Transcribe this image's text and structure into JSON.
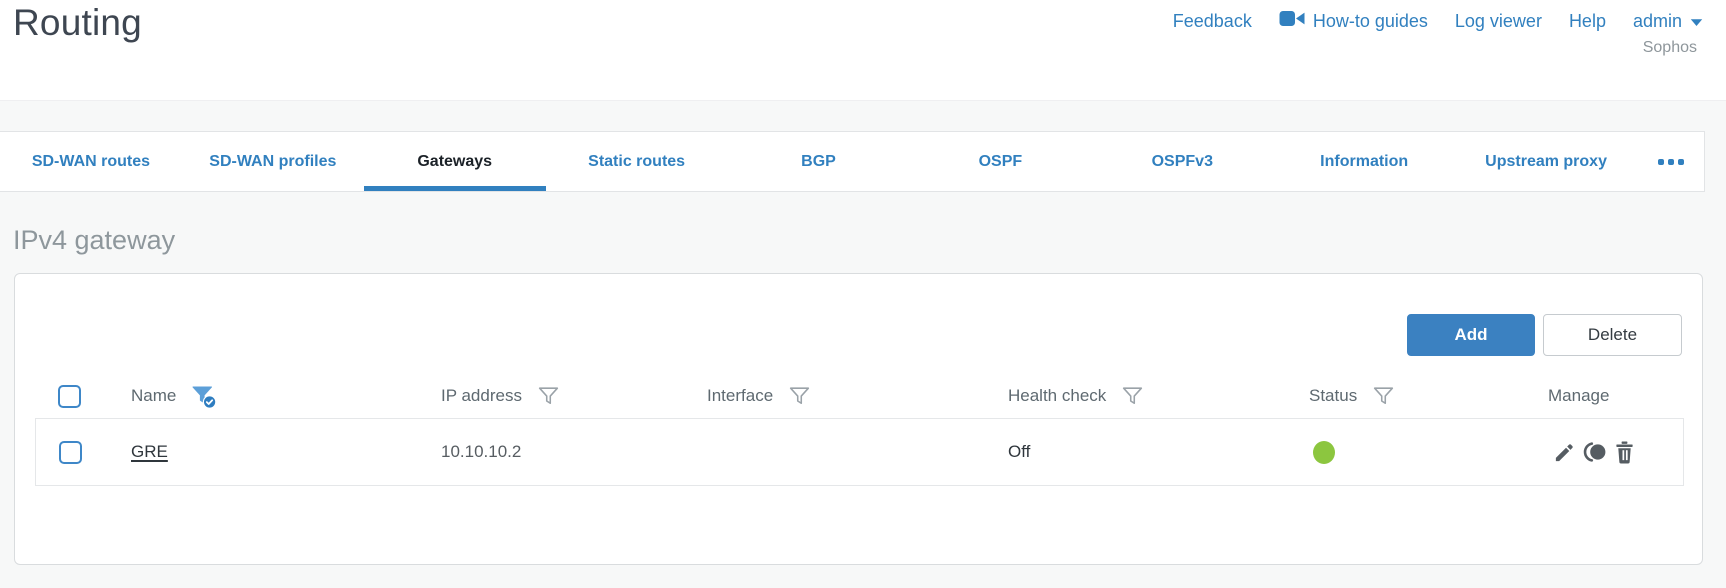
{
  "header": {
    "title": "Routing",
    "links": [
      {
        "label": "Feedback"
      },
      {
        "label": "How-to guides"
      },
      {
        "label": "Log viewer"
      },
      {
        "label": "Help"
      },
      {
        "label": "admin"
      }
    ],
    "brand": "Sophos"
  },
  "tabs": {
    "items": [
      {
        "label": "SD-WAN routes",
        "active": false
      },
      {
        "label": "SD-WAN profiles",
        "active": false
      },
      {
        "label": "Gateways",
        "active": true
      },
      {
        "label": "Static routes",
        "active": false
      },
      {
        "label": "BGP",
        "active": false
      },
      {
        "label": "OSPF",
        "active": false
      },
      {
        "label": "OSPFv3",
        "active": false
      },
      {
        "label": "Information",
        "active": false
      },
      {
        "label": "Upstream proxy",
        "active": false
      }
    ],
    "overflow_icon": "ellipsis-icon"
  },
  "section": {
    "heading": "IPv4 gateway"
  },
  "toolbar": {
    "add_label": "Add",
    "delete_label": "Delete"
  },
  "table": {
    "columns": [
      {
        "label": "Name",
        "filter": "active"
      },
      {
        "label": "IP address",
        "filter": "inactive"
      },
      {
        "label": "Interface",
        "filter": "inactive"
      },
      {
        "label": "Health check",
        "filter": "inactive"
      },
      {
        "label": "Status",
        "filter": "inactive"
      },
      {
        "label": "Manage",
        "filter": "none"
      }
    ],
    "rows": [
      {
        "name": "GRE",
        "ip_address": "10.10.10.2",
        "interface": "",
        "health_check": "Off",
        "status": "up"
      }
    ]
  },
  "colors": {
    "accent_blue": "#3180bf",
    "status_green": "#8cc63f",
    "active_tab_text": "#1b2127"
  }
}
